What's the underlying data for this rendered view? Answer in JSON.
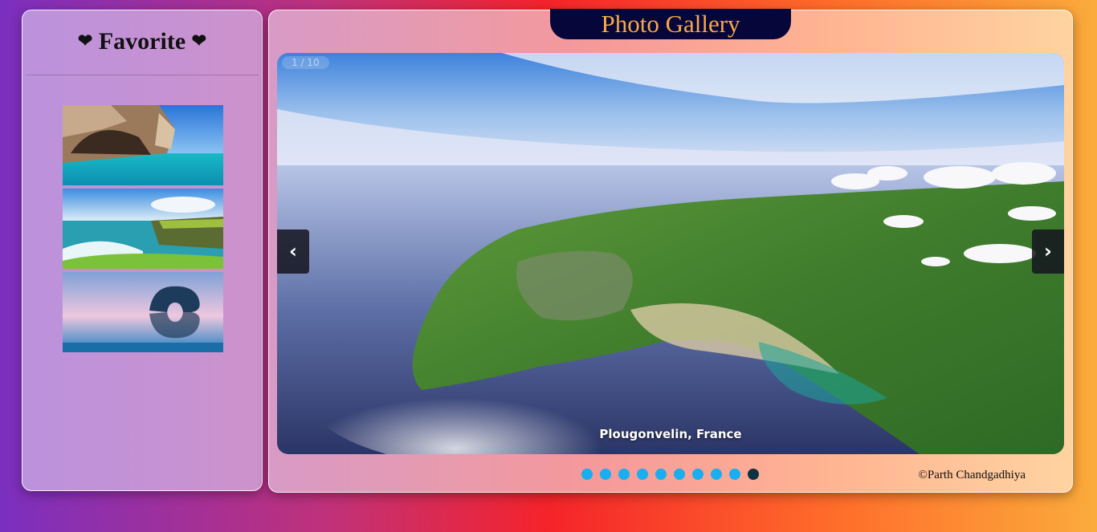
{
  "sidebar": {
    "title": "Favorite",
    "heart_glyph": "❤",
    "thumbnails": [
      {
        "icon": "sea-cave-photo"
      },
      {
        "icon": "coastal-waves-photo"
      },
      {
        "icon": "rock-in-lake-photo"
      }
    ]
  },
  "gallery": {
    "title": "Photo Gallery",
    "counter": "1 / 10",
    "caption": "Plougonvelin, France",
    "prev_label": "‹",
    "next_label": "›",
    "copyright": "©Parth Chandgadhiya",
    "slides_total": 10,
    "active_slide": 10
  },
  "colors": {
    "title_tab_bg": "#06063a",
    "title_text": "#f6a94a",
    "dot": "#19aef0",
    "dot_active": "#0d3342"
  }
}
